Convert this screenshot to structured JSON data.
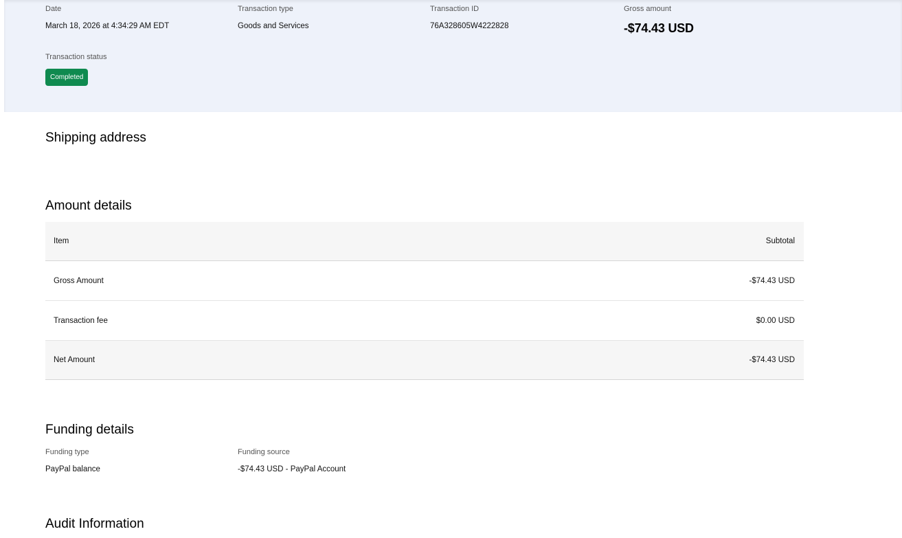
{
  "summary": {
    "date_label": "Date",
    "date_value": "March 18, 2026 at 4:34:29 AM EDT",
    "type_label": "Transaction type",
    "type_value": "Goods and Services",
    "id_label": "Transaction ID",
    "id_value": "76A328605W4222828",
    "gross_label": "Gross amount",
    "gross_value": "-$74.43 USD",
    "status_label": "Transaction status",
    "status_value": "Completed",
    "status_color": "#0f8a4f",
    "panel_color": "#eef2fa"
  },
  "shipping": {
    "title": "Shipping address"
  },
  "amount_details": {
    "title": "Amount details",
    "columns": [
      "Item",
      "Subtotal"
    ],
    "rows": [
      {
        "item": "Gross Amount",
        "subtotal": "-$74.43 USD"
      },
      {
        "item": "Transaction fee",
        "subtotal": "$0.00 USD"
      },
      {
        "item": "Net Amount",
        "subtotal": "-$74.43 USD"
      }
    ]
  },
  "funding": {
    "title": "Funding details",
    "type_label": "Funding type",
    "type_value": "PayPal balance",
    "source_label": "Funding source",
    "source_value": "-$74.43 USD - PayPal Account"
  },
  "audit": {
    "title": "Audit Information"
  }
}
